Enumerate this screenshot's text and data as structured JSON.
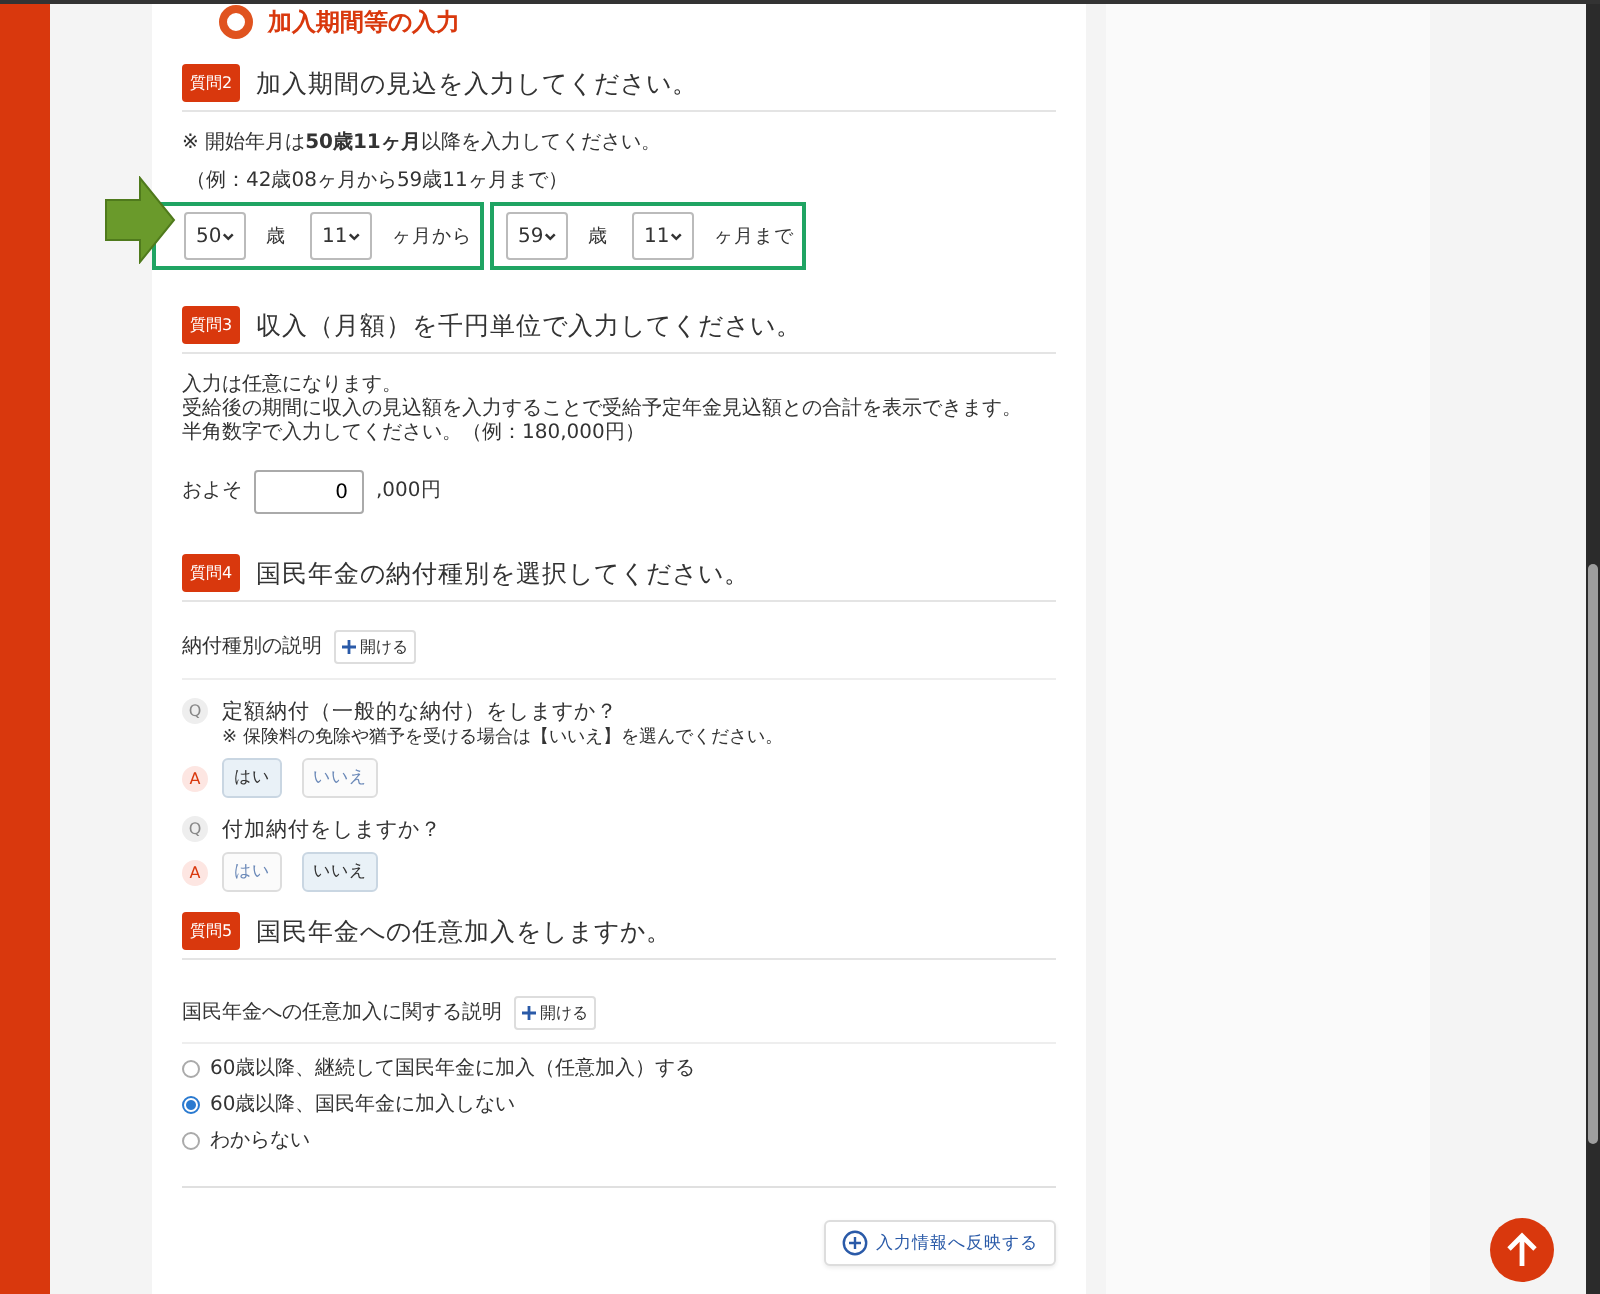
{
  "section": {
    "title": "加入期間等の入力"
  },
  "q2": {
    "badge": "質問2",
    "title": "加入期間の見込を入力してください。",
    "note": "※ 開始年月は**50歳11ヶ月**以降を入力してください。",
    "example": "（例：42歳08ヶ月から59歳11ヶ月まで）",
    "ranges": [
      {
        "selects": [
          {
            "value": "50",
            "unit": "歳"
          },
          {
            "value": "11",
            "unit": "ヶ月から"
          }
        ]
      },
      {
        "selects": [
          {
            "value": "59",
            "unit": "歳"
          },
          {
            "value": "11",
            "unit": "ヶ月まで"
          }
        ]
      }
    ]
  },
  "q3": {
    "badge": "質問3",
    "title": "収入（月額）を千円単位で入力してください。",
    "lines": [
      "入力は任意になります。",
      "受給後の期間に収入の見込額を入力することで受給予定年金見込額との合計を表示できます。",
      "半角数字で入力してください。（例：180,000円）"
    ],
    "prefix": "およそ",
    "value": "0",
    "suffix": ",000円"
  },
  "q4": {
    "badge": "質問4",
    "title": "国民年金の納付種別を選択してください。",
    "explain_label": "納付種別の説明",
    "open_button": "開ける",
    "items": [
      {
        "q_mark": "Q",
        "question": "定額納付（一般的な納付）をしますか？",
        "note": "※ 保険料の免除や猶予を受ける場合は【いいえ】を選んでください。",
        "a_mark": "A",
        "options": [
          {
            "label": "はい",
            "selected": true
          },
          {
            "label": "いいえ",
            "selected": false
          }
        ]
      },
      {
        "q_mark": "Q",
        "question": "付加納付をしますか？",
        "a_mark": "A",
        "options": [
          {
            "label": "はい",
            "selected": false
          },
          {
            "label": "いいえ",
            "selected": true
          }
        ]
      }
    ]
  },
  "q5": {
    "badge": "質問5",
    "title": "国民年金への任意加入をしますか。",
    "explain_label": "国民年金への任意加入に関する説明",
    "open_button": "開ける",
    "radios": [
      {
        "label": "60歳以降、継続して国民年金に加入（任意加入）する",
        "selected": false
      },
      {
        "label": "60歳以降、国民年金に加入しない",
        "selected": true
      },
      {
        "label": "わからない",
        "selected": false
      }
    ]
  },
  "submit_button": "入力情報へ反映する"
}
